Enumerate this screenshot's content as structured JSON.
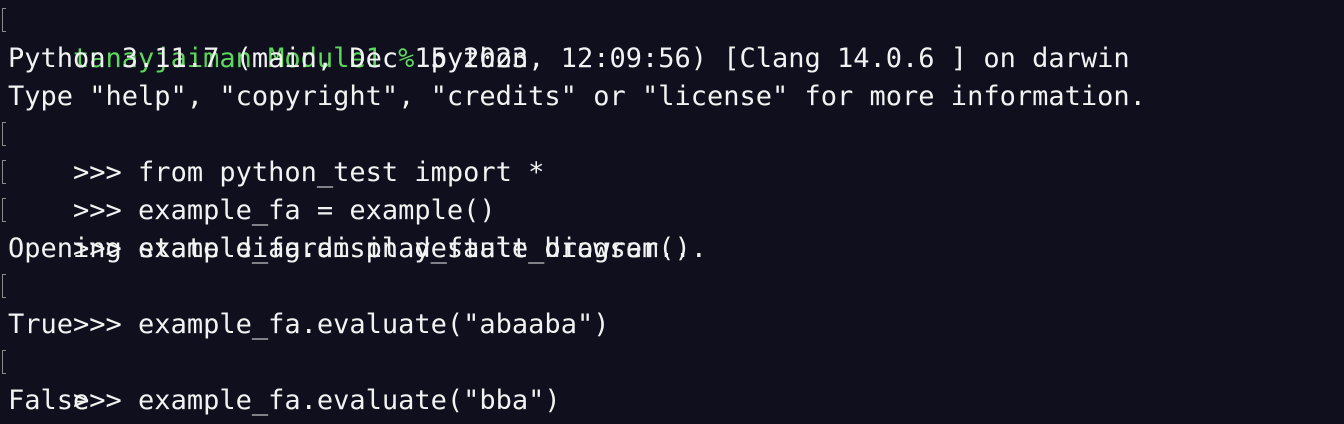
{
  "terminal": {
    "prompt": {
      "user": "tanayjaiman",
      "directory": "Module1",
      "symbol": "%",
      "command": "python"
    },
    "lines": [
      "Python 3.11.7 (main, Dec 15 2023, 12:09:56) [Clang 14.0.6 ] on darwin",
      "Type \"help\", \"copyright\", \"credits\" or \"license\" for more information.",
      ">>> from python_test import *",
      ">>> example_fa = example()",
      ">>> example_fa.display_state_diagram()",
      "Opening state diagram in default browser...",
      ">>> example_fa.evaluate(\"abaaba\")",
      "True",
      ">>> example_fa.evaluate(\"bba\")",
      "False"
    ]
  },
  "colors": {
    "background": "#0f0f1e",
    "text": "#f2f2f2",
    "prompt": "#5fd75f"
  }
}
